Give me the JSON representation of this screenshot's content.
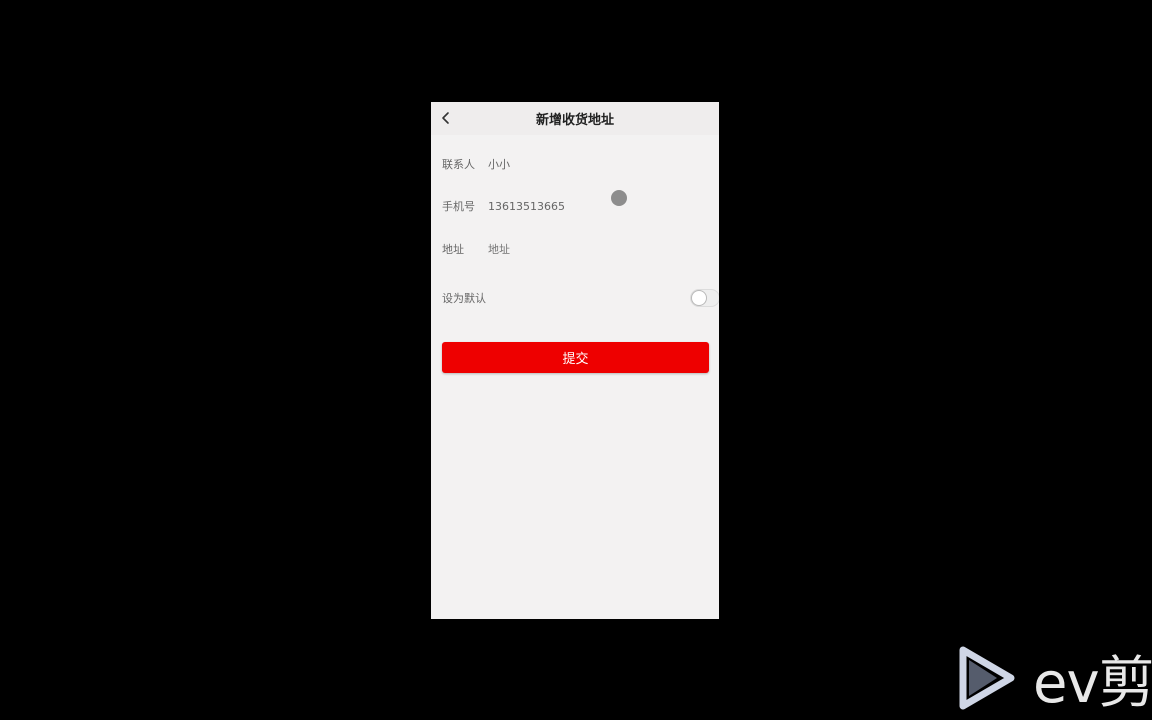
{
  "nav": {
    "title": "新增收货地址",
    "back_icon": "chevron-left-icon"
  },
  "form": {
    "contact": {
      "label": "联系人",
      "value": "小小"
    },
    "phone": {
      "label": "手机号",
      "value": "13613513665"
    },
    "address": {
      "label": "地址",
      "placeholder": "地址"
    },
    "default": {
      "label": "设为默认",
      "checked": false
    }
  },
  "submit": {
    "label": "提交"
  },
  "watermark": {
    "text": "ev剪"
  },
  "colors": {
    "accent": "#ee0000",
    "page_bg": "#f3f2f2",
    "backdrop": "#000000"
  }
}
